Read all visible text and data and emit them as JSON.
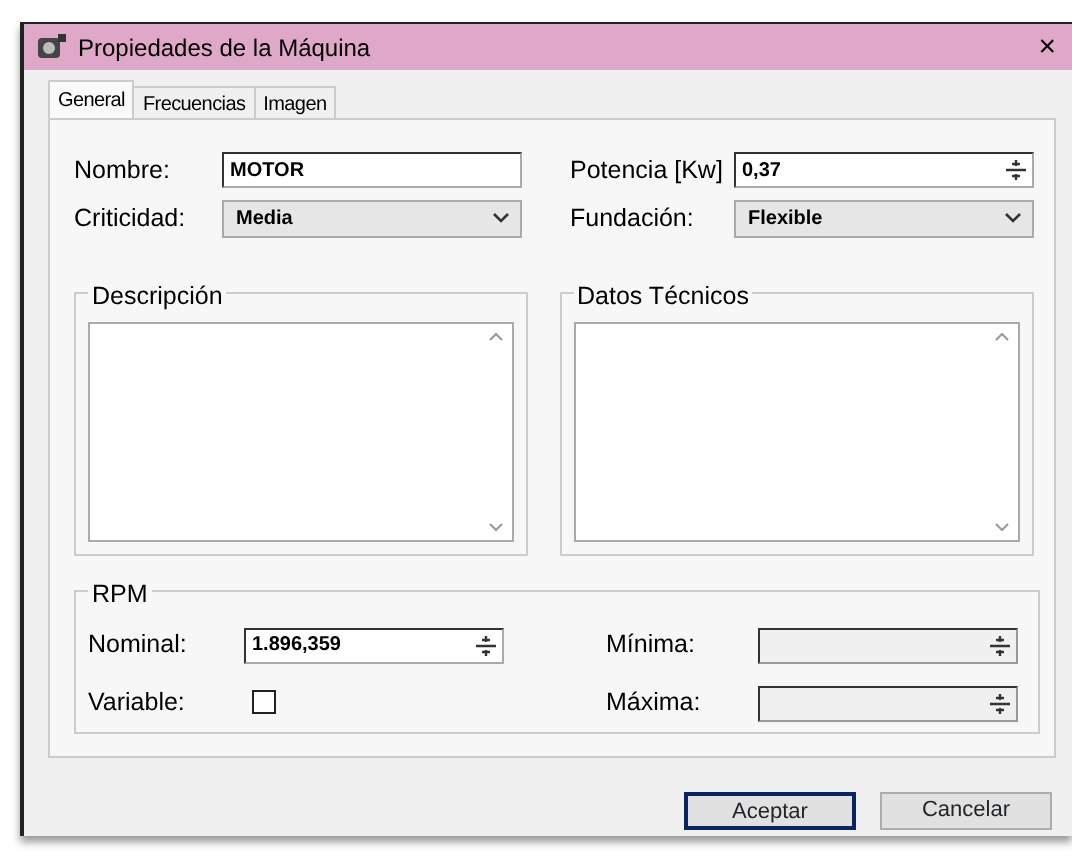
{
  "window": {
    "title": "Propiedades de la Máquina",
    "close": "×"
  },
  "tabs": [
    {
      "label": "General",
      "selected": true
    },
    {
      "label": "Frecuencias",
      "selected": false
    },
    {
      "label": "Imagen",
      "selected": false
    }
  ],
  "fields": [
    {
      "label": "Nombre:",
      "value": "MOTOR",
      "kind": "text"
    },
    {
      "label": "Potencia [Kw]",
      "value": "0,37",
      "kind": "spin"
    },
    {
      "label": "Criticidad:",
      "value": "Media",
      "kind": "select"
    },
    {
      "label": "Fundación:",
      "value": "Flexible",
      "kind": "select"
    }
  ],
  "text_areas": [
    {
      "label": "Descripción"
    },
    {
      "label": "Datos Técnicos"
    }
  ],
  "rpm": {
    "title": "RPM",
    "fields": [
      {
        "label": "Nominal:",
        "value": "1.896,359",
        "kind": "spin",
        "disabled": false
      },
      {
        "label": "Mínima:",
        "kind": "spin",
        "disabled": true
      },
      {
        "label": "Variable:",
        "kind": "checkbox",
        "checked": false
      },
      {
        "label": "Máxima:",
        "kind": "spin",
        "disabled": true
      }
    ]
  },
  "buttons": [
    {
      "label": "Aceptar",
      "default": true
    },
    {
      "label": "Cancelar",
      "default": false
    }
  ]
}
